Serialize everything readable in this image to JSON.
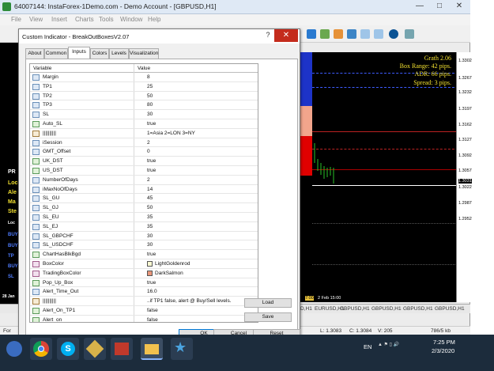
{
  "window": {
    "title": "64007144: InstaForex-1Demo.com - Demo Account - [GBPUSD,H1]",
    "minimize": "—",
    "maximize": "□",
    "close": "✕"
  },
  "menu": [
    "File",
    "View",
    "Insert",
    "Charts",
    "Tools",
    "Window",
    "Help"
  ],
  "dialog": {
    "title": "Custom Indicator - BreakOutBoxesV2.07",
    "help_label": "?",
    "close_label": "✕",
    "tabs": [
      "About",
      "Common",
      "Inputs",
      "Colors",
      "Levels",
      "Visualization"
    ],
    "active_tab": "Inputs",
    "grid_header": {
      "variable": "Variable",
      "value": "Value"
    },
    "rows": [
      {
        "icon": "123",
        "name": "Margin",
        "value": "8"
      },
      {
        "icon": "123",
        "name": "TP1",
        "value": "25"
      },
      {
        "icon": "123",
        "name": "TP2",
        "value": "50"
      },
      {
        "icon": "123",
        "name": "TP3",
        "value": "80"
      },
      {
        "icon": "123",
        "name": "SL",
        "value": "30"
      },
      {
        "icon": "bool",
        "name": "Auto_SL",
        "value": "true"
      },
      {
        "icon": "abc",
        "name": "||||||||||",
        "value": "1=Asia 2=LON 3=NY"
      },
      {
        "icon": "123",
        "name": "iSession",
        "value": "2"
      },
      {
        "icon": "123",
        "name": "GMT_Offset",
        "value": "0"
      },
      {
        "icon": "bool",
        "name": "UK_DST",
        "value": "true"
      },
      {
        "icon": "bool",
        "name": "US_DST",
        "value": "true"
      },
      {
        "icon": "123",
        "name": "NumberOfDays",
        "value": "2"
      },
      {
        "icon": "123",
        "name": "iMaxNoOfDays",
        "value": "14"
      },
      {
        "icon": "123",
        "name": "SL_GU",
        "value": "45"
      },
      {
        "icon": "123",
        "name": "SL_GJ",
        "value": "50"
      },
      {
        "icon": "123",
        "name": "SL_EU",
        "value": "35"
      },
      {
        "icon": "123",
        "name": "SL_EJ",
        "value": "35"
      },
      {
        "icon": "123",
        "name": "SL_GBPCHF",
        "value": "30"
      },
      {
        "icon": "123",
        "name": "SL_USDCHF",
        "value": "30"
      },
      {
        "icon": "bool",
        "name": "ChartHasBlkBgd",
        "value": "true"
      },
      {
        "icon": "color",
        "name": "BoxColor",
        "value": "LightGoldenrod",
        "swatch": "#fafad2"
      },
      {
        "icon": "color",
        "name": "TradingBoxColor",
        "value": "DarkSalmon",
        "swatch": "#e9967a"
      },
      {
        "icon": "bool",
        "name": "Pop_Up_Box",
        "value": "true"
      },
      {
        "icon": "123",
        "name": "Alert_Time_Out",
        "value": "16.0"
      },
      {
        "icon": "abc",
        "name": "||||||||||",
        "value": "..if TP1 false, alert @ Buy/Sell levels."
      },
      {
        "icon": "bool",
        "name": "Alert_On_TP1",
        "value": "false"
      },
      {
        "icon": "bool",
        "name": "Alert_on",
        "value": "false"
      }
    ],
    "buttons": {
      "load": "Load",
      "save": "Save",
      "ok": "OK",
      "cancel": "Cancel",
      "reset": "Reset"
    }
  },
  "chart": {
    "info_lines": [
      "Grath 2.06",
      "Box Range: 42 pips.",
      "ADR: 66 pips.",
      "Spread: 3 pips."
    ],
    "prices": [
      "1.3302",
      "1.3267",
      "1.3232",
      "1.3197",
      "1.3162",
      "1.3127",
      "1.3092",
      "1.3057",
      "1.3031",
      "1.3022",
      "1.2987",
      "1.2952"
    ],
    "time_labels": [
      "7:00",
      "2 Feb 15:00"
    ],
    "colors": {
      "box_blue": "#1d33c8",
      "box_red": "#e00000",
      "box_salmon": "#f2a58c",
      "info_text": "#f2e030",
      "candle": "#29c229"
    }
  },
  "left_panel": [
    "PR",
    "Loc",
    "Ale",
    "Ma",
    "Ste",
    "Loc",
    "BUY",
    "BUY",
    "TP",
    "BUY",
    "SL",
    "28 Jan"
  ],
  "symbol_tabs": [
    "D,H1",
    "EURUSD,H1",
    "GBPUSD,H1",
    "GBPUSD,H1",
    "GBPUSD,H1",
    "GBPUSD,H1"
  ],
  "status_bar": [
    "For",
    "L: 1.3083",
    "C: 1.3084",
    "V: 205",
    "786/5 kb"
  ],
  "taskbar": {
    "language": "EN",
    "time": "7:25 PM",
    "date": "2/3/2020"
  }
}
